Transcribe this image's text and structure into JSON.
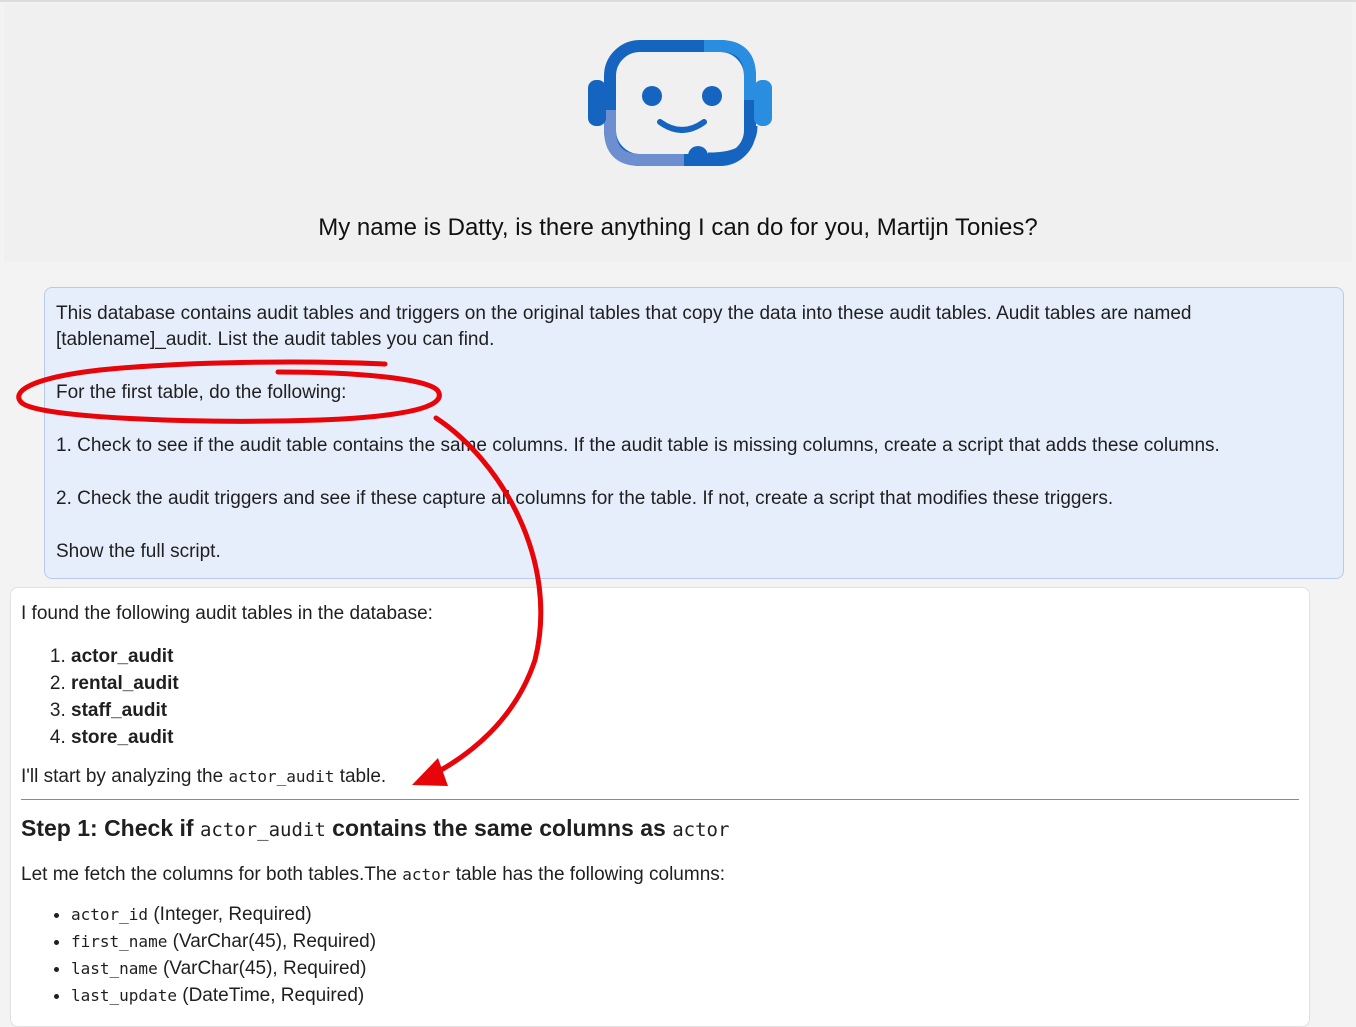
{
  "header": {
    "greeting": "My name is Datty, is there anything I can do for you, Martijn Tonies?"
  },
  "user_message": {
    "paragraphs": [
      "This database contains audit tables and triggers on the original tables that copy the data into these audit tables. Audit tables are named [tablename]_audit. List the audit tables you can find.",
      "For the first table, do the following:",
      "1. Check to see if the audit table contains the same columns. If the audit table is missing columns, create a script that adds these columns.",
      "2. Check the audit triggers and see if these capture all columns for the table. If not, create a script that modifies these triggers.",
      "Show the full script."
    ]
  },
  "bot_message": {
    "intro": "I found the following audit tables in the database:",
    "audit_tables": [
      "actor_audit",
      "rental_audit",
      "staff_audit",
      "store_audit"
    ],
    "start_prefix": "I'll start by analyzing the ",
    "start_code": "actor_audit",
    "start_suffix": " table.",
    "step1": {
      "prefix": "Step 1: Check if ",
      "code1": "actor_audit",
      "middle": " contains the same columns as ",
      "code2": "actor"
    },
    "fetch_prefix": "Let me fetch the columns for both tables.The ",
    "fetch_code": "actor",
    "fetch_suffix": " table has the following columns:",
    "columns": [
      {
        "name": "actor_id",
        "desc": " (Integer, Required)"
      },
      {
        "name": "first_name",
        "desc": " (VarChar(45), Required)"
      },
      {
        "name": "last_name",
        "desc": " (VarChar(45), Required)"
      },
      {
        "name": "last_update",
        "desc": " (DateTime, Required)"
      }
    ]
  },
  "colors": {
    "annotation": "#e8050a",
    "logo_dark": "#1565c0",
    "logo_light": "#2a8ee0",
    "user_bubble": "#e6eefb"
  },
  "icons": {
    "logo": "robot-headset-icon"
  }
}
